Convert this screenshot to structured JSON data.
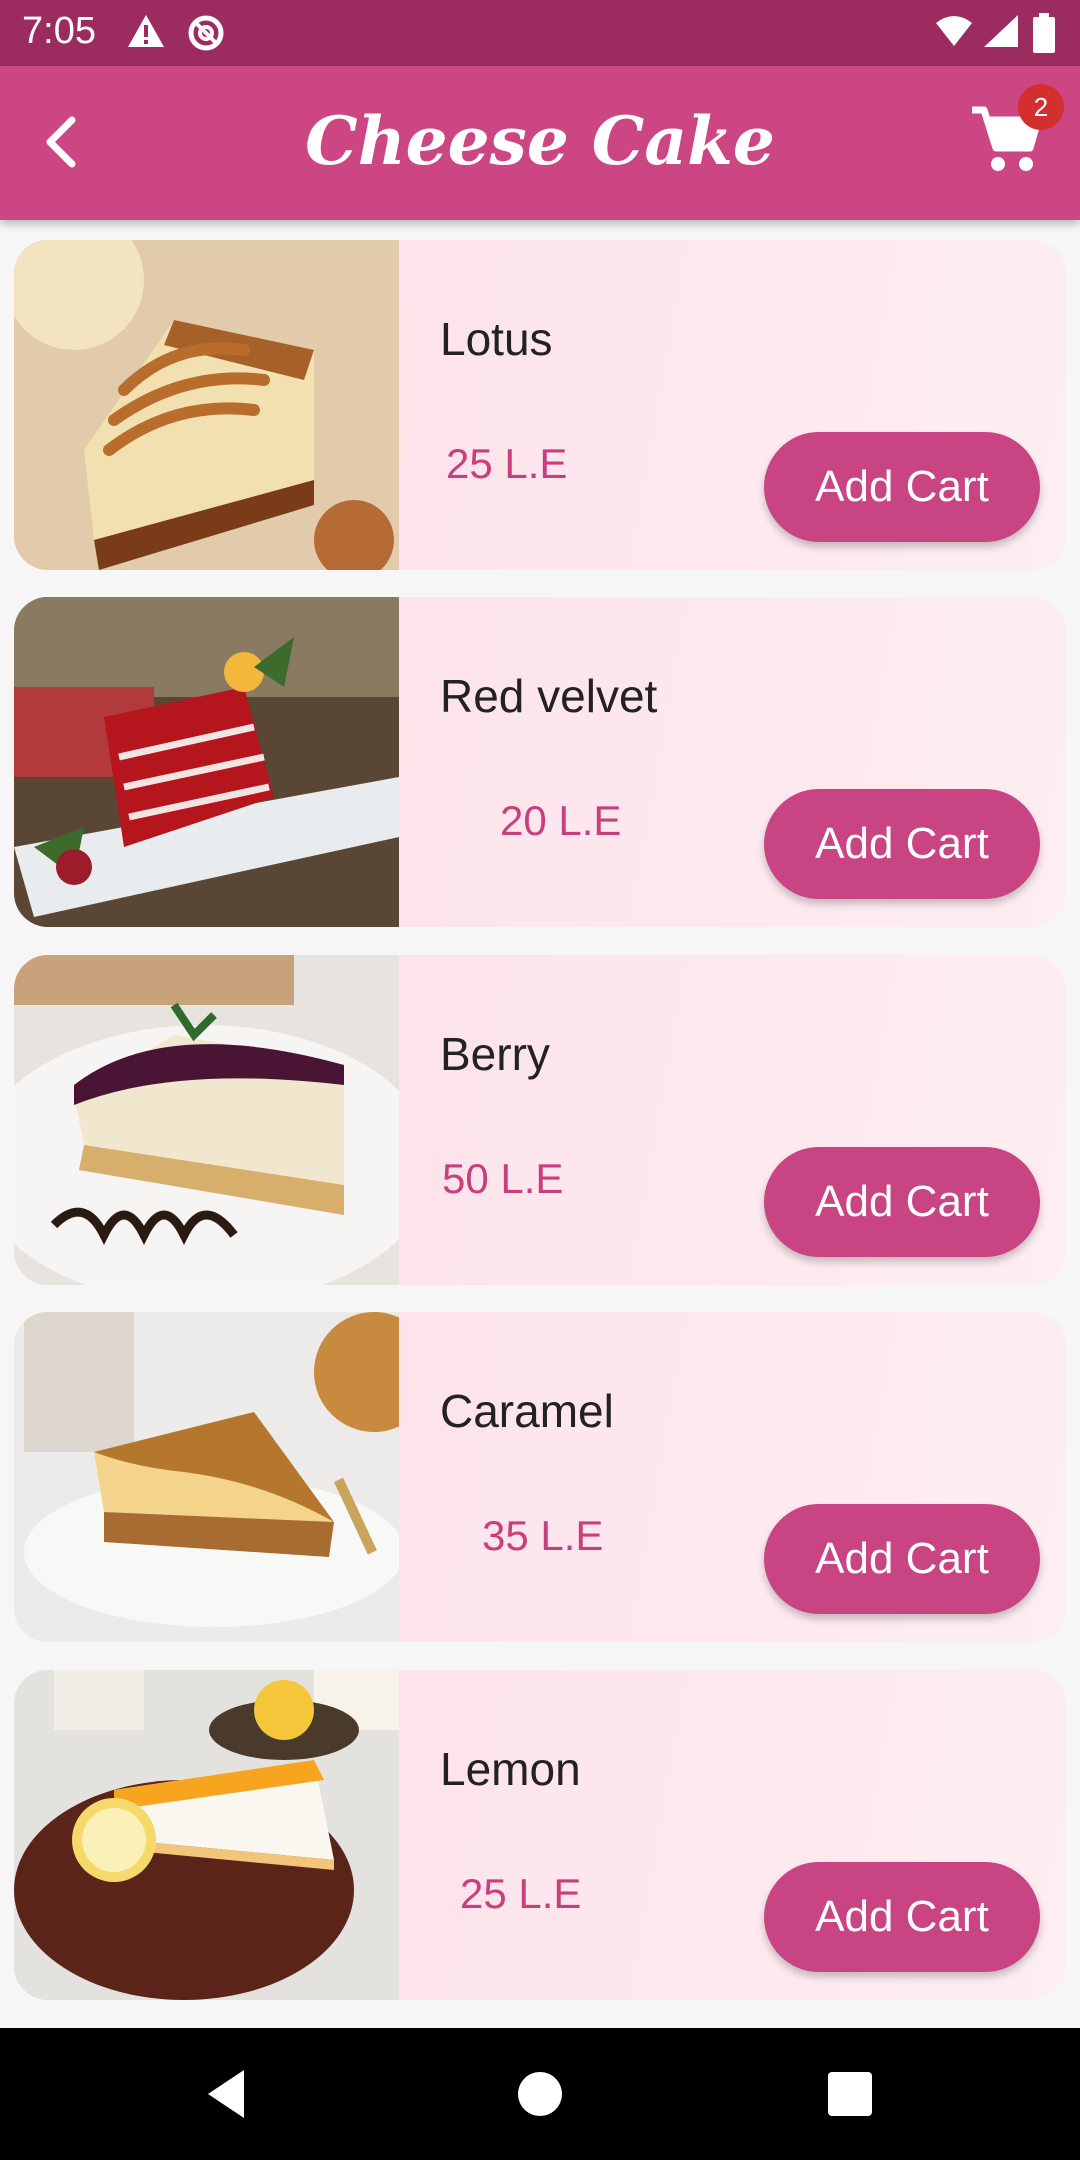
{
  "status_bar": {
    "time": "7:05",
    "icons": [
      "alert-icon",
      "sync-icon",
      "wifi-icon",
      "signal-icon",
      "battery-icon"
    ]
  },
  "app_bar": {
    "title": "Cheese Cake",
    "back_icon": "back-arrow-icon",
    "cart_icon": "cart-icon",
    "cart_count": "2",
    "color": "#cc4684"
  },
  "products": [
    {
      "name": "Lotus",
      "price": "25 L.E",
      "button": "Add Cart",
      "image": "lotus-cheesecake-photo"
    },
    {
      "name": "Red velvet",
      "price": "20 L.E",
      "button": "Add Cart",
      "image": "red-velvet-cake-photo"
    },
    {
      "name": "Berry",
      "price": "50 L.E",
      "button": "Add Cart",
      "image": "berry-cheesecake-photo"
    },
    {
      "name": "Caramel",
      "price": "35 L.E",
      "button": "Add Cart",
      "image": "caramel-cheesecake-photo"
    },
    {
      "name": "Lemon",
      "price": "25 L.E",
      "button": "Add Cart",
      "image": "lemon-cheesecake-photo"
    }
  ],
  "nav_bar": {
    "back": "nav-back-icon",
    "home": "nav-home-icon",
    "recents": "nav-recents-icon"
  }
}
